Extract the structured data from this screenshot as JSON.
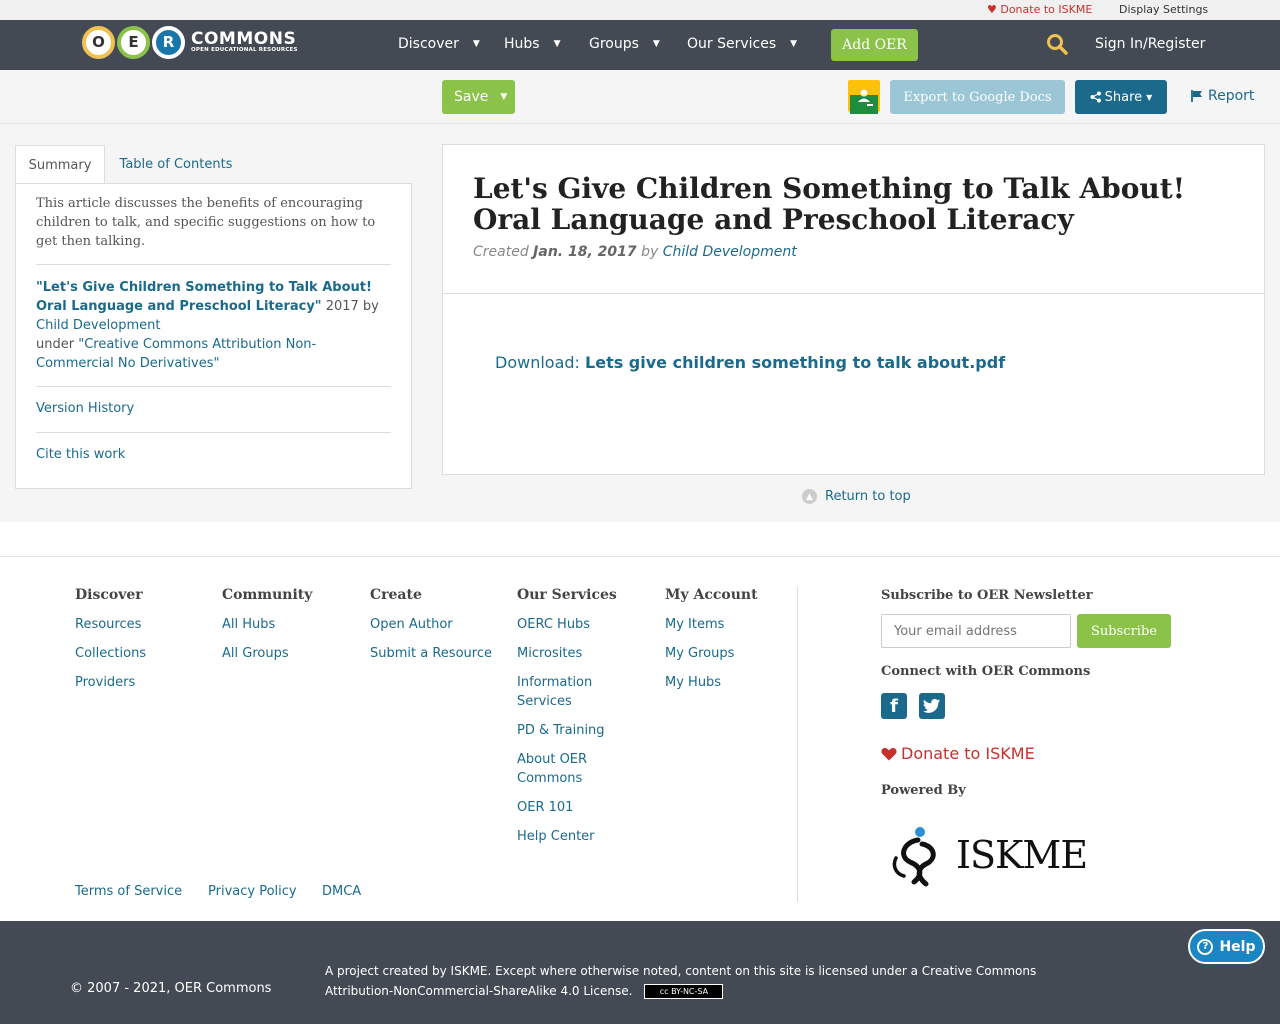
{
  "utility": {
    "donate_label": "Donate to ISKME",
    "display_settings_label": "Display Settings"
  },
  "nav": {
    "logo_letters": [
      "O",
      "E",
      "R"
    ],
    "logo_word": "COMMONS",
    "logo_tagline": "OPEN EDUCATIONAL RESOURCES",
    "items": [
      {
        "label": "Discover"
      },
      {
        "label": "Hubs"
      },
      {
        "label": "Groups"
      },
      {
        "label": "Our Services"
      }
    ],
    "add_oer_label": "Add OER",
    "search_icon": "search-icon",
    "signin_label": "Sign In/Register"
  },
  "toolbar": {
    "save_label": "Save",
    "export_label": "Export to Google Docs",
    "share_label": "Share",
    "report_label": "Report"
  },
  "sidebar": {
    "tabs": [
      {
        "label": "Summary",
        "active": true
      },
      {
        "label": "Table of Contents",
        "active": false
      }
    ],
    "summary_text": "This article discusses the benefits of encouraging children to talk, and specific suggestions on how to get then talking.",
    "attribution": {
      "title": "\"Let's Give Children Something to Talk About! Oral Language and Preschool Literacy\"",
      "year_by": " 2017 by ",
      "author": "Child Development",
      "under": "under ",
      "license": "\"Creative Commons Attribution Non-Commercial No Derivatives\""
    },
    "version_history_label": "Version History",
    "cite_label": "Cite this work"
  },
  "main": {
    "title": "Let's Give Children Something to Talk About! Oral Language and Preschool Literacy",
    "created_prefix": "Created ",
    "created_date": "Jan. 18, 2017",
    "created_by": " by ",
    "author": "Child Development",
    "download_prefix": "Download: ",
    "download_file": "Lets give children something to talk about.pdf",
    "return_top_label": "Return to top"
  },
  "footer": {
    "columns": [
      {
        "heading": "Discover",
        "links": [
          "Resources",
          "Collections",
          "Providers"
        ]
      },
      {
        "heading": "Community",
        "links": [
          "All Hubs",
          "All Groups"
        ]
      },
      {
        "heading": "Create",
        "links": [
          "Open Author",
          "Submit a Resource"
        ]
      },
      {
        "heading": "Our Services",
        "links": [
          "OERC Hubs",
          "Microsites",
          "Information Services",
          "PD & Training",
          "About OER Commons",
          "OER 101",
          "Help Center"
        ]
      },
      {
        "heading": "My Account",
        "links": [
          "My Items",
          "My Groups",
          "My Hubs"
        ]
      }
    ],
    "subscribe_heading": "Subscribe to OER Newsletter",
    "email_placeholder": "Your email address",
    "subscribe_label": "Subscribe",
    "connect_heading": "Connect with OER Commons",
    "social": [
      {
        "icon": "facebook-icon",
        "glyph": "f"
      },
      {
        "icon": "twitter-icon",
        "glyph": "t"
      }
    ],
    "donate_label": "Donate to ISKME",
    "powered_heading": "Powered By",
    "powered_logo": "ISKME",
    "bottom_links": [
      "Terms of Service",
      "Privacy Policy",
      "DMCA"
    ]
  },
  "bottom": {
    "copyright": "© 2007 - 2021, OER Commons",
    "license_text": "A project created by ISKME. Except where otherwise noted, content on this site is licensed under a Creative Commons Attribution-NonCommercial-ShareAlike 4.0 License.",
    "cc_badge": "cc BY-NC-SA",
    "help_label": "Help"
  },
  "colors": {
    "nav_bg": "#434a54",
    "accent_green": "#8bc34a",
    "link_blue": "#1b6a8c",
    "donate_red": "#c9302c",
    "export_blue": "#9bc6d6"
  }
}
